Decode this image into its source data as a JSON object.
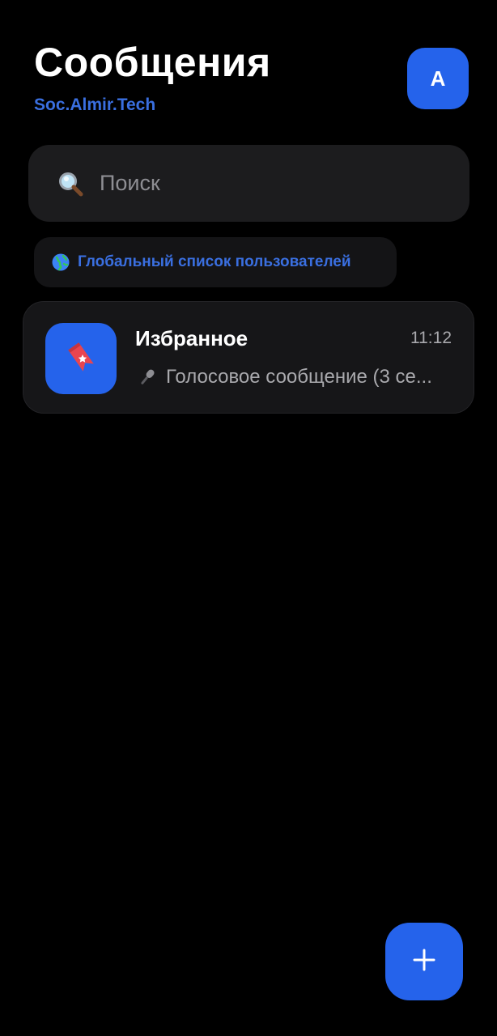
{
  "header": {
    "title": "Сообщения",
    "subtitle": "Soc.Almir.Tech",
    "avatar_letter": "A"
  },
  "search": {
    "placeholder": "Поиск",
    "value": "",
    "icon": "search-icon"
  },
  "global_users": {
    "label": "Глобальный список пользователей",
    "icon": "globe-icon"
  },
  "chats": [
    {
      "name": "Избранное",
      "time": "11:12",
      "preview": "Голосовое сообщение (3 се...",
      "preview_icon": "microphone-icon",
      "avatar_icon": "bookmark-icon"
    }
  ],
  "fab": {
    "label": "+",
    "icon": "plus-icon"
  },
  "colors": {
    "background": "#000000",
    "accent": "#2563eb",
    "subtitle_accent": "#3a6fe0",
    "surface": "#1c1c1e",
    "card": "#161618",
    "muted_text": "#a9a9ad"
  }
}
